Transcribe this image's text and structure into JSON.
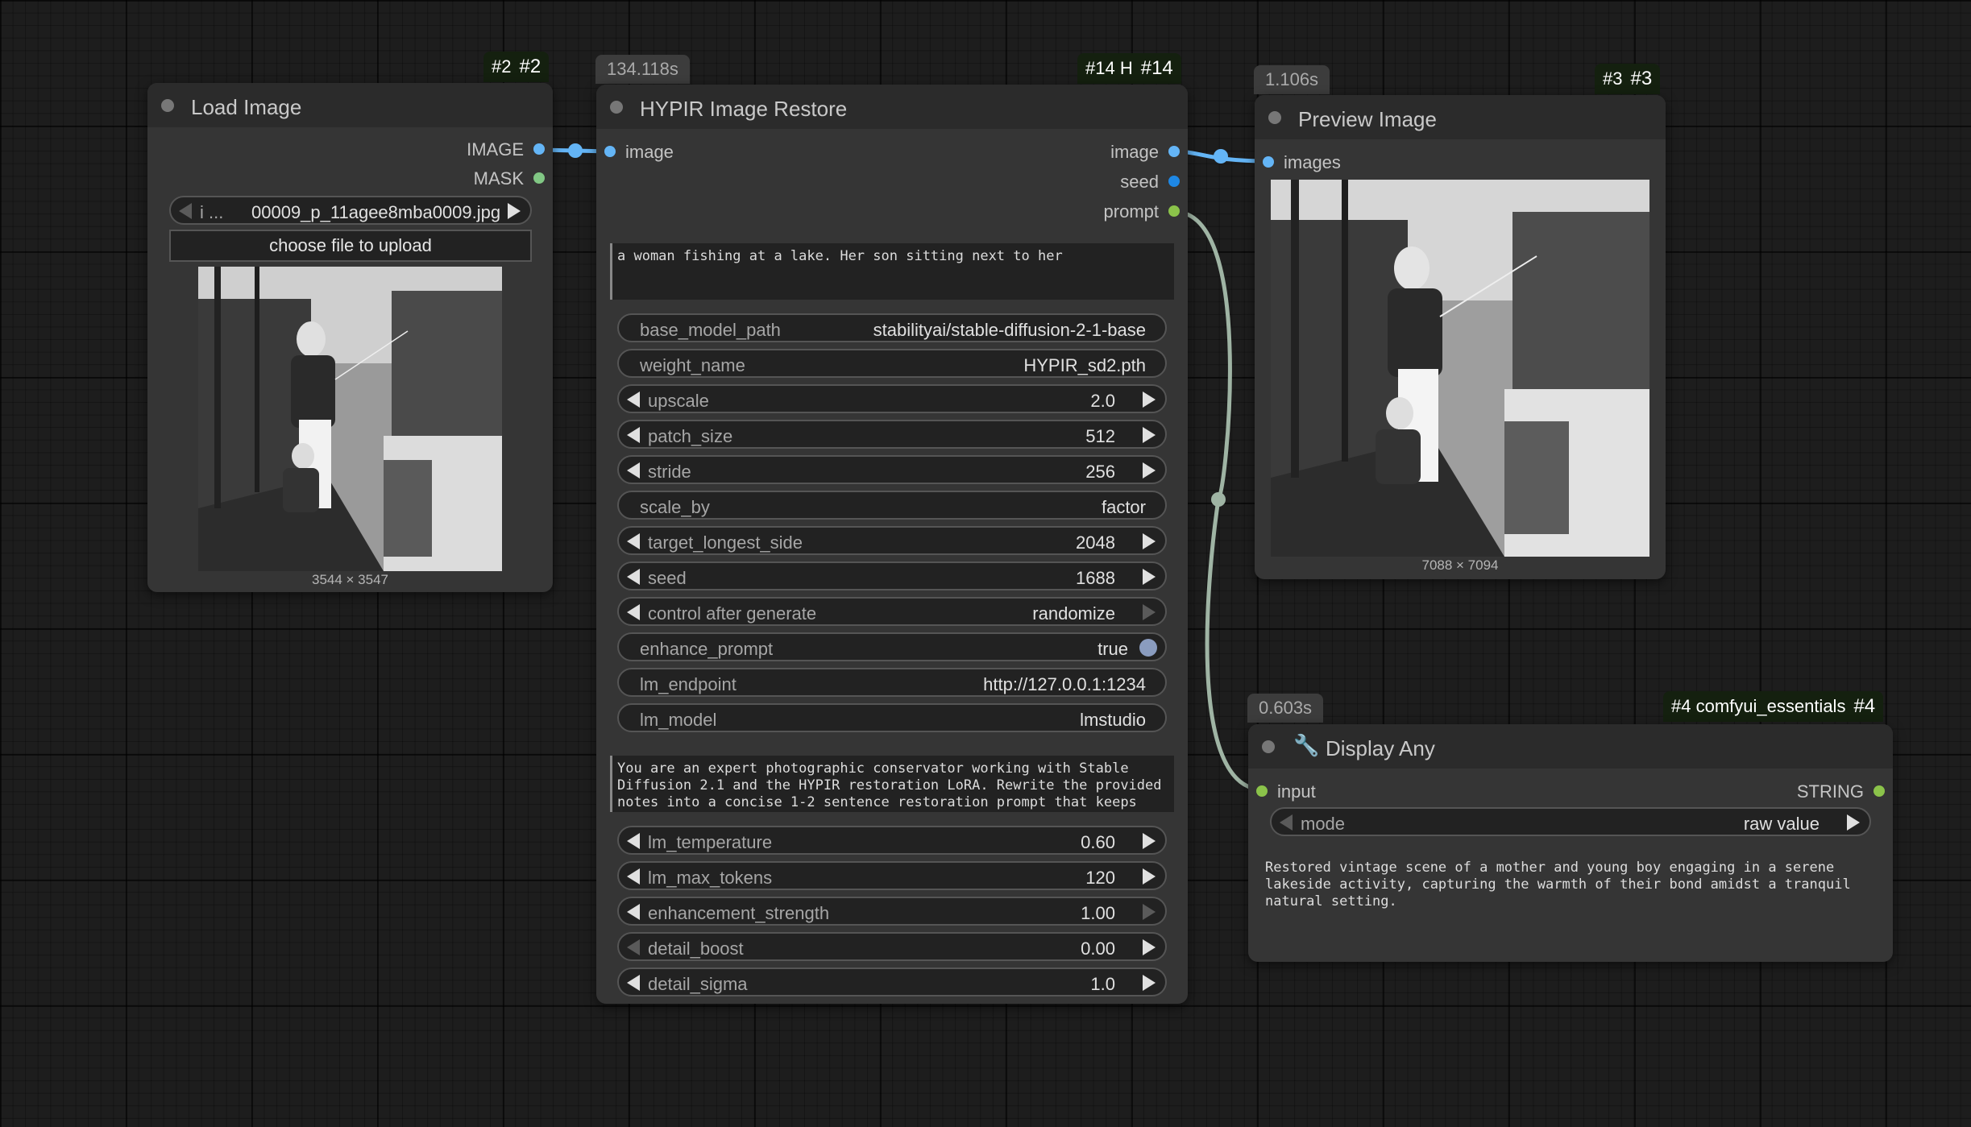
{
  "nodes": {
    "load_image": {
      "id_small": "#2",
      "id_big": "#2",
      "title": "Load Image",
      "outputs": [
        "IMAGE",
        "MASK"
      ],
      "file_combo": {
        "prefix": "i ...",
        "value": "00009_p_11agee8mba0009.jpg"
      },
      "upload_label": "choose file to upload",
      "image_size": "3544 × 3547"
    },
    "hypir": {
      "id_small": "#14 H",
      "id_big": "#14",
      "time": "134.118s",
      "title": "HYPIR Image Restore",
      "input": "image",
      "outputs": [
        "image",
        "seed",
        "prompt"
      ],
      "prompt_text": "a woman fishing at a lake. Her son sitting next to her",
      "widgets": [
        {
          "label": "base_model_path",
          "value": "stabilityai/stable-diffusion-2-1-base"
        },
        {
          "label": "weight_name",
          "value": "HYPIR_sd2.pth"
        },
        {
          "label": "upscale",
          "value": "2.0"
        },
        {
          "label": "patch_size",
          "value": "512"
        },
        {
          "label": "stride",
          "value": "256"
        },
        {
          "label": "scale_by",
          "value": "factor"
        },
        {
          "label": "target_longest_side",
          "value": "2048"
        },
        {
          "label": "seed",
          "value": "1688"
        },
        {
          "label": "control after generate",
          "value": "randomize"
        },
        {
          "label": "enhance_prompt",
          "value": "true"
        },
        {
          "label": "lm_endpoint",
          "value": "http://127.0.0.1:1234"
        },
        {
          "label": "lm_model",
          "value": "lmstudio"
        }
      ],
      "system_prompt": "You are an expert photographic conservator working with Stable Diffusion 2.1 and the HYPIR restoration LoRA. Rewrite the provided notes into a concise 1-2 sentence restoration prompt that keeps",
      "widgets2": [
        {
          "label": "lm_temperature",
          "value": "0.60"
        },
        {
          "label": "lm_max_tokens",
          "value": "120"
        },
        {
          "label": "enhancement_strength",
          "value": "1.00"
        },
        {
          "label": "detail_boost",
          "value": "0.00"
        },
        {
          "label": "detail_sigma",
          "value": "1.0"
        }
      ]
    },
    "preview": {
      "id_small": "#3",
      "id_big": "#3",
      "time": "1.106s",
      "title": "Preview Image",
      "input": "images",
      "image_size": "7088 × 7094"
    },
    "display": {
      "id_small": "#4 comfyui_essentials",
      "id_big": "#4",
      "time": "0.603s",
      "title": "Display Any",
      "title_icon": "wrench-icon",
      "input": "input",
      "output": "STRING",
      "mode_label": "mode",
      "mode_value": "raw value",
      "output_text": "Restored vintage scene of a mother and young boy engaging in a serene lakeside activity, capturing the warmth of their bond amidst a tranquil natural setting."
    }
  },
  "colors": {
    "image_link": "#64b5f6",
    "string_link": "#9fb4a4",
    "canvas": "#1d1d1d",
    "node_body": "#353535",
    "node_header": "#2b2b2b",
    "badge_bg": "#14200f"
  }
}
